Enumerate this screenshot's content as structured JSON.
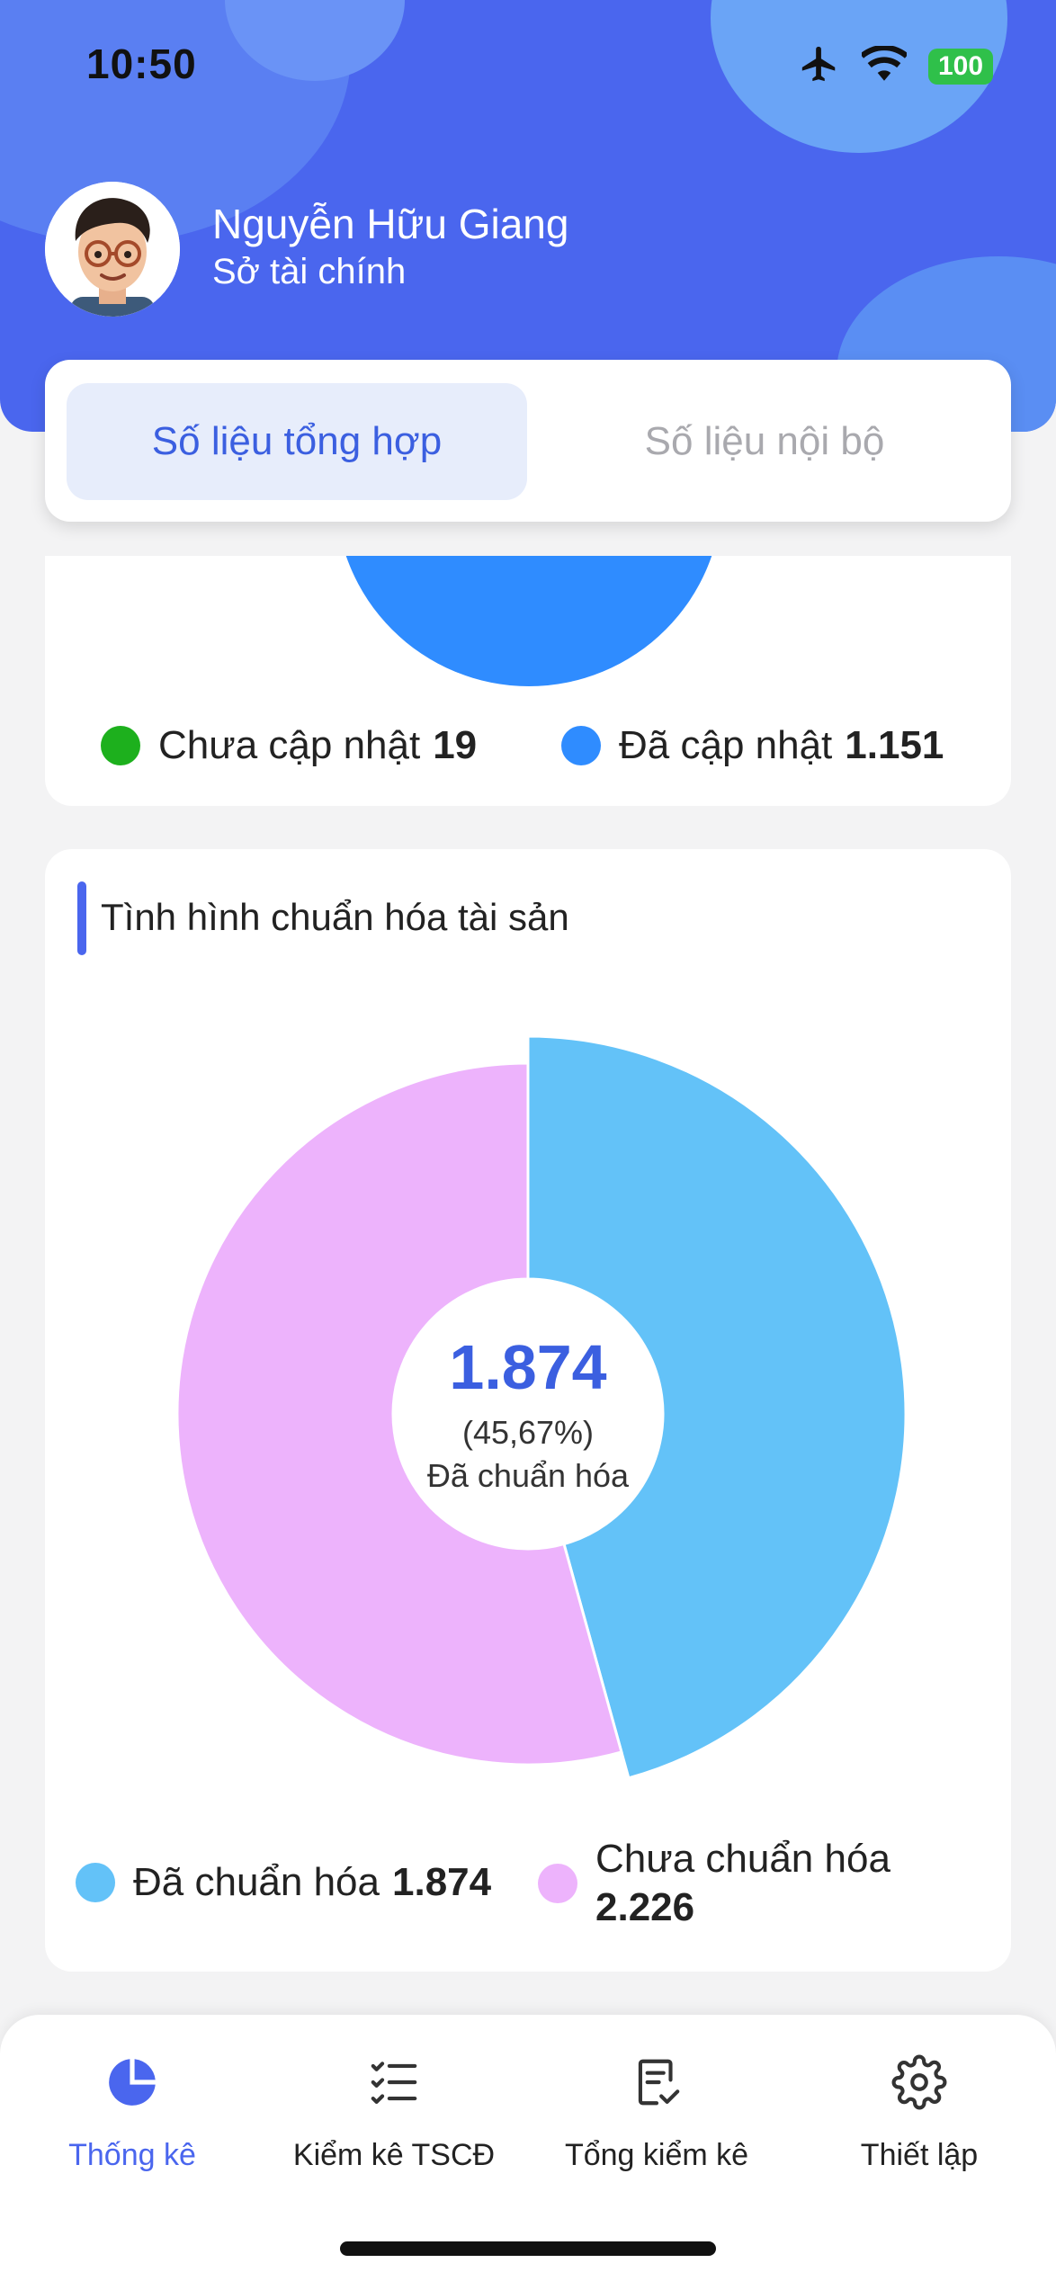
{
  "status_bar": {
    "time": "10:50",
    "battery": "100"
  },
  "user": {
    "name": "Nguyễn Hữu Giang",
    "organization": "Sở tài chính"
  },
  "tabs": [
    {
      "label": "Số liệu tổng hợp",
      "active": true
    },
    {
      "label": "Số liệu nội bộ",
      "active": false
    }
  ],
  "update_card": {
    "legend": [
      {
        "label": "Chưa cập nhật",
        "value": "19",
        "color": "#1db01d"
      },
      {
        "label": "Đã cập nhật",
        "value": "1.151",
        "color": "#2f8cff"
      }
    ]
  },
  "standardization_card": {
    "title": "Tình hình chuẩn hóa tài sản",
    "center_value": "1.874",
    "center_percent": "(45,67%)",
    "center_label": "Đã chuẩn hóa",
    "legend": [
      {
        "label": "Đã chuẩn hóa",
        "value": "1.874",
        "color": "#63c2f8"
      },
      {
        "label": "Chưa chuẩn hóa",
        "value": "2.226",
        "color": "#edb3fc"
      }
    ]
  },
  "chart_data": {
    "type": "pie",
    "title": "Tình hình chuẩn hóa tài sản",
    "categories": [
      "Đã chuẩn hóa",
      "Chưa chuẩn hóa"
    ],
    "values": [
      1874,
      2226
    ],
    "colors": [
      "#63c2f8",
      "#edb3fc"
    ]
  },
  "nav": [
    {
      "label": "Thống kê",
      "icon": "pie-chart-icon",
      "active": true
    },
    {
      "label": "Kiểm kê TSCĐ",
      "icon": "checklist-icon",
      "active": false
    },
    {
      "label": "Tổng kiểm kê",
      "icon": "document-check-icon",
      "active": false
    },
    {
      "label": "Thiết lập",
      "icon": "gear-icon",
      "active": false
    }
  ]
}
